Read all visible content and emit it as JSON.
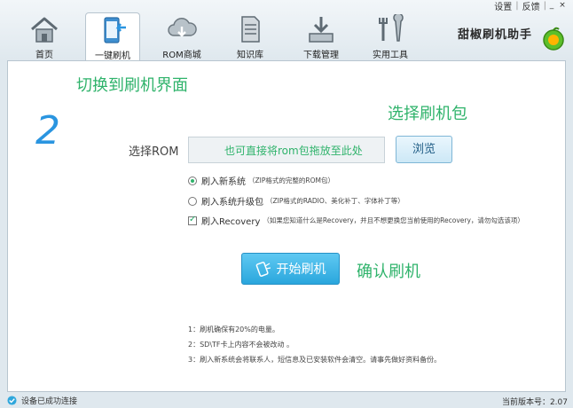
{
  "topbar": {
    "settings": "设置",
    "feedback": "反馈",
    "minimize": "_",
    "close": "×",
    "sep": "|"
  },
  "tabs": [
    {
      "label": "首页",
      "icon": "home-icon"
    },
    {
      "label": "一键刷机",
      "icon": "phone-flash-icon"
    },
    {
      "label": "ROM商城",
      "icon": "cloud-download-icon"
    },
    {
      "label": "知识库",
      "icon": "document-icon"
    },
    {
      "label": "下载管理",
      "icon": "download-tray-icon"
    },
    {
      "label": "实用工具",
      "icon": "tools-icon"
    }
  ],
  "brand": {
    "name": "甜椒刷机助手"
  },
  "annotations": {
    "switch": "切换到刷机界面",
    "choose_pkg": "选择刷机包",
    "confirm": "确认刷机",
    "step": "2"
  },
  "rom": {
    "label": "选择ROM",
    "placeholder": "也可直接将rom包拖放至此处",
    "browse": "浏览"
  },
  "options": [
    {
      "type": "radio",
      "checked": true,
      "label": "刷入新系统",
      "note": "（ZIP格式的完整的ROM包）"
    },
    {
      "type": "radio",
      "checked": false,
      "label": "刷入系统升级包",
      "note": "（ZIP格式的RADIO、美化补丁、字体补丁等）"
    },
    {
      "type": "checkbox",
      "checked": true,
      "label": "刷入Recovery",
      "note": "（如果您知道什么是Recovery，并且不想更换您当前使用的Recovery，请勿勾选该项）"
    }
  ],
  "start_button": "开始刷机",
  "notes": [
    "1：刷机确保有20%的电量。",
    "2：SD\\TF卡上内容不会被改动 。",
    "3：刷入新系统会将联系人，短信息及已安装软件会清空。请事先做好资料备份。"
  ],
  "status": {
    "connected": "设备已成功连接",
    "version": "当前版本号：2.07"
  }
}
